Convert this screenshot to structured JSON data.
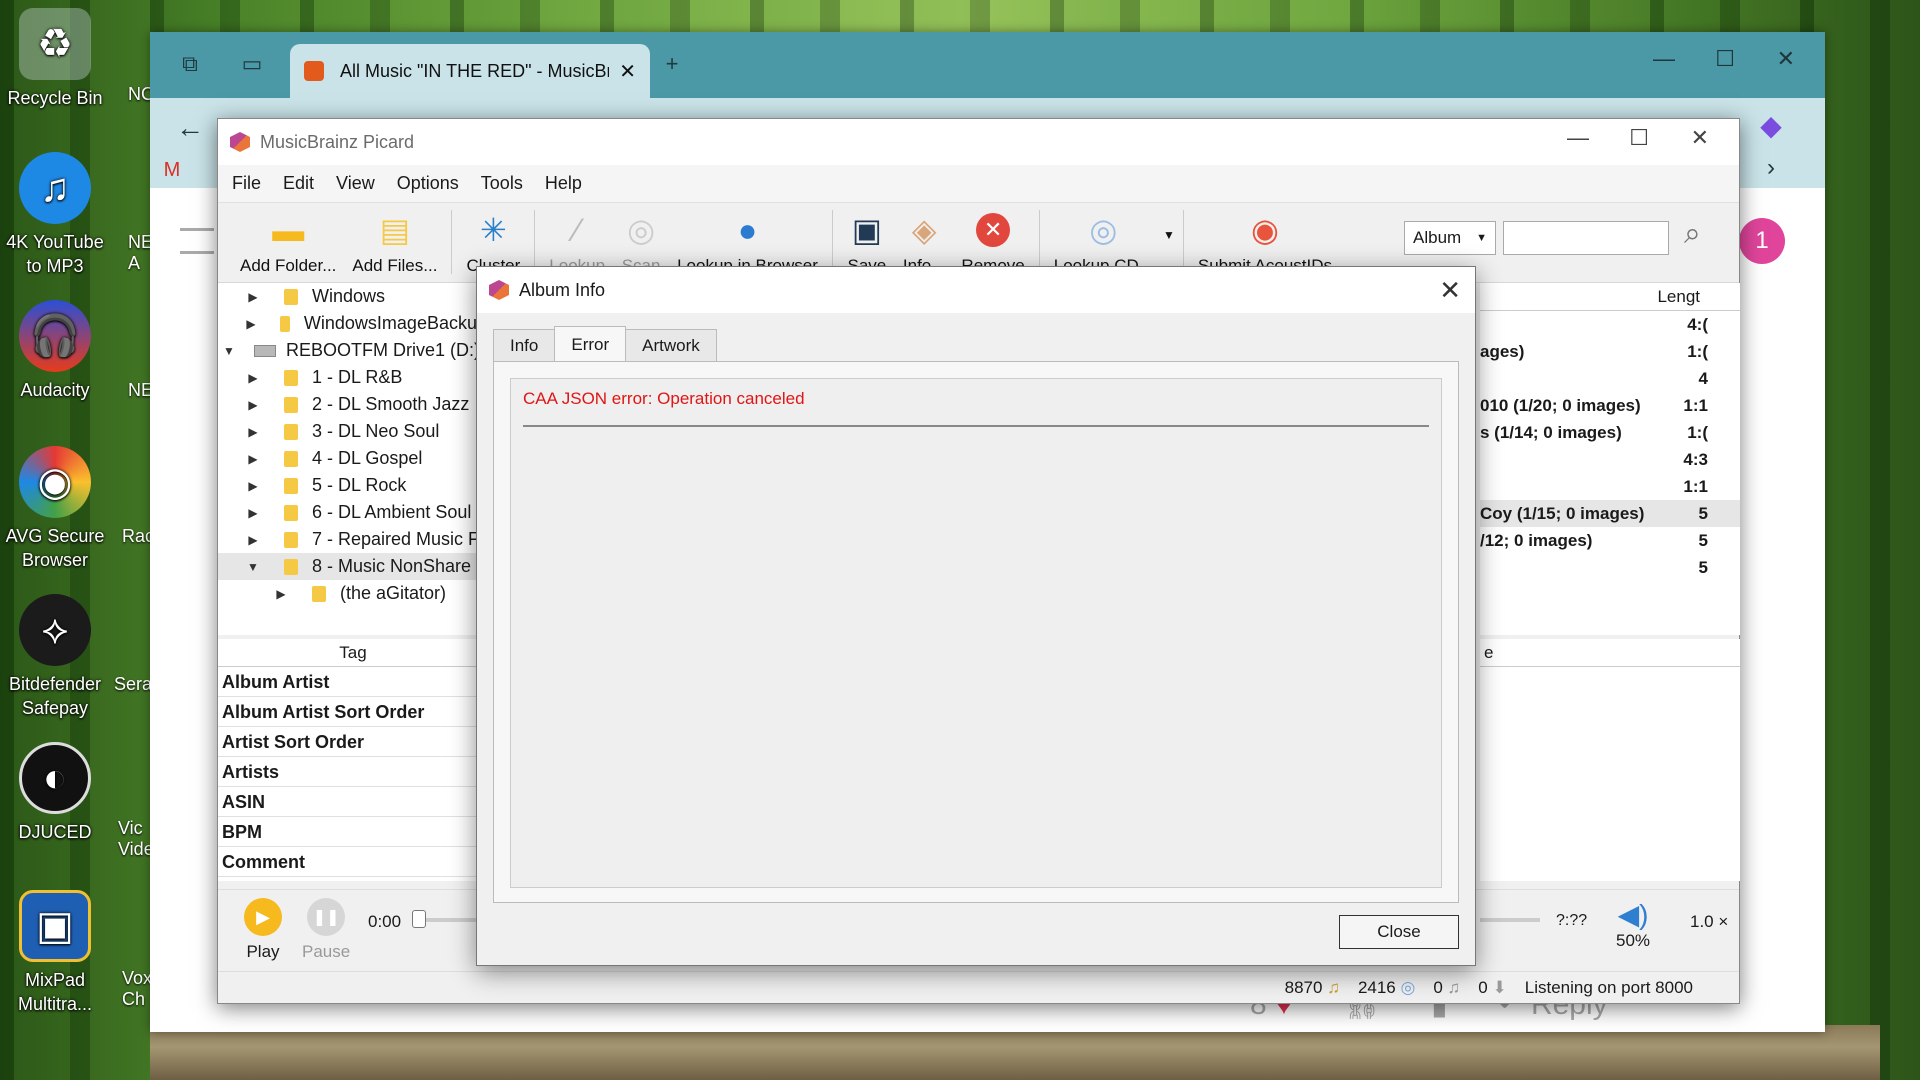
{
  "desktop": {
    "icons": [
      {
        "label": "Recycle Bin",
        "icon": "recycle-bin-icon"
      },
      {
        "label": "4K YouTube to MP3",
        "icon": "cloud-music-icon"
      },
      {
        "label": "Audacity",
        "icon": "headphones-icon"
      },
      {
        "label": "AVG Secure Browser",
        "icon": "browser-icon"
      },
      {
        "label": "Bitdefender Safepay",
        "icon": "bitdefender-icon"
      },
      {
        "label": "DJUCED",
        "icon": "djuced-icon"
      },
      {
        "label": "MixPad Multitra...",
        "icon": "mixpad-icon"
      }
    ],
    "col2": [
      "NC",
      "NE A",
      "NE",
      "Rac",
      "Sera",
      "Vic Vide",
      "Vox Ch"
    ]
  },
  "browser": {
    "tab_title": "All Music \"IN THE RED\" - MusicBr",
    "footer": {
      "likes": "8",
      "reply": "Reply"
    },
    "badge": "1"
  },
  "picard": {
    "title": "MusicBrainz Picard",
    "menu": [
      "File",
      "Edit",
      "View",
      "Options",
      "Tools",
      "Help"
    ],
    "toolbar": [
      {
        "label": "Add Folder...",
        "icon": "folder-icon",
        "enabled": true
      },
      {
        "label": "Add Files...",
        "icon": "files-icon",
        "enabled": true
      },
      {
        "label": "Cluster",
        "icon": "cluster-icon",
        "enabled": true
      },
      {
        "label": "Lookup",
        "icon": "magic-wand-icon",
        "enabled": false
      },
      {
        "label": "Scan",
        "icon": "fingerprint-icon",
        "enabled": false
      },
      {
        "label": "Lookup in Browser",
        "icon": "globe-icon",
        "enabled": true
      },
      {
        "label": "Save",
        "icon": "save-icon",
        "enabled": true
      },
      {
        "label": "Info...",
        "icon": "info-tag-icon",
        "enabled": true
      },
      {
        "label": "Remove",
        "icon": "remove-icon",
        "enabled": true
      },
      {
        "label": "Lookup CD...",
        "icon": "cd-icon",
        "enabled": true
      },
      {
        "label": "Submit AcoustIDs",
        "icon": "acoustid-icon",
        "enabled": true
      }
    ],
    "search_mode": "Album",
    "search_value": "",
    "tree": [
      {
        "label": "Windows",
        "type": "folder",
        "level": 1,
        "expanded": false
      },
      {
        "label": "WindowsImageBackup",
        "type": "folder",
        "level": 1,
        "expanded": false
      },
      {
        "label": "REBOOTFM Drive1 (D:)",
        "type": "drive",
        "level": 0,
        "expanded": true
      },
      {
        "label": "1 - DL R&B",
        "type": "folder",
        "level": 1,
        "expanded": false
      },
      {
        "label": "2 - DL Smooth Jazz",
        "type": "folder",
        "level": 1,
        "expanded": false
      },
      {
        "label": "3 - DL Neo Soul",
        "type": "folder",
        "level": 1,
        "expanded": false
      },
      {
        "label": "4 - DL Gospel",
        "type": "folder",
        "level": 1,
        "expanded": false
      },
      {
        "label": "5 - DL Rock",
        "type": "folder",
        "level": 1,
        "expanded": false
      },
      {
        "label": "6 - DL Ambient Soul",
        "type": "folder",
        "level": 1,
        "expanded": false
      },
      {
        "label": "7 - Repaired Music F",
        "type": "folder",
        "level": 1,
        "expanded": false
      },
      {
        "label": "8 - Music NonShare",
        "type": "folder",
        "level": 1,
        "expanded": true,
        "selected": true
      },
      {
        "label": "(the aGitator)",
        "type": "folder",
        "level": 2,
        "expanded": false
      }
    ],
    "right_header": "Lengt",
    "right_rows": [
      {
        "text": "",
        "len": "4:("
      },
      {
        "text": "ages)",
        "len": "1:("
      },
      {
        "text": "",
        "len": "4"
      },
      {
        "text": "010 (1/20; 0 images)",
        "len": "1:1"
      },
      {
        "text": "s (1/14; 0 images)",
        "len": "1:("
      },
      {
        "text": "",
        "len": "4:3"
      },
      {
        "text": "",
        "len": "1:1"
      },
      {
        "text": "Coy (1/15; 0 images)",
        "len": "5",
        "selected": true
      },
      {
        "text": "/12; 0 images)",
        "len": "5"
      },
      {
        "text": "",
        "len": "5"
      }
    ],
    "tag_header": "Tag",
    "tags_right_header": "e",
    "tags": [
      "Album Artist",
      "Album Artist Sort Order",
      "Artist Sort Order",
      "Artists",
      "ASIN",
      "BPM",
      "Comment"
    ],
    "player": {
      "play": "Play",
      "pause": "Pause",
      "time": "0:00",
      "remaining": "?:??",
      "volume": "50%",
      "speed": "1.0 ×"
    },
    "status": {
      "files": "8870",
      "albums": "2416",
      "pending": "0",
      "requests": "0",
      "listening": "Listening on port 8000"
    }
  },
  "dialog": {
    "title": "Album Info",
    "tabs": [
      "Info",
      "Error",
      "Artwork"
    ],
    "active_tab": "Error",
    "error_text": "CAA JSON error: Operation canceled",
    "close_label": "Close",
    "error_color": "#e01515"
  }
}
